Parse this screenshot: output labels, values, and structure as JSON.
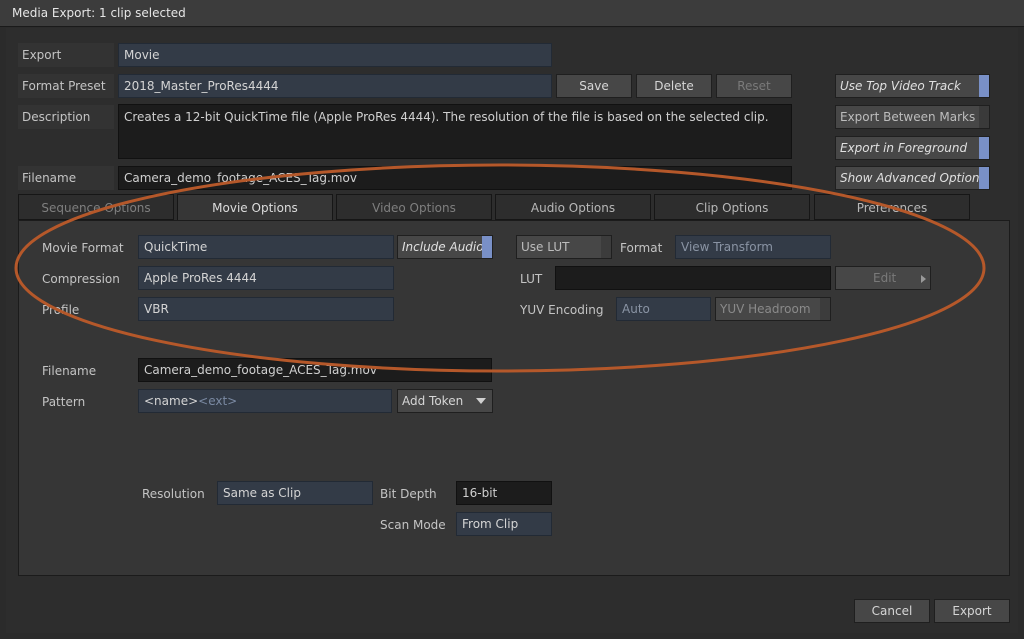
{
  "window": {
    "title": "Media Export: 1 clip selected"
  },
  "export": {
    "label": "Export",
    "value": "Movie"
  },
  "format_preset": {
    "label": "Format Preset",
    "value": "2018_Master_ProRes4444",
    "save": "Save",
    "delete": "Delete",
    "reset": "Reset"
  },
  "description": {
    "label": "Description",
    "value": "Creates a 12-bit QuickTime file (Apple ProRes 4444).  The resolution of the file is based on the selected clip."
  },
  "filename_top": {
    "label": "Filename",
    "value": "Camera_demo_footage_ACES_Tag.mov"
  },
  "toggles": {
    "use_top_video_track": "Use Top Video Track",
    "export_between_marks": "Export Between Marks",
    "export_in_foreground": "Export in Foreground",
    "show_advanced_options": "Show Advanced Options"
  },
  "tabs": [
    "Sequence Options",
    "Movie Options",
    "Video Options",
    "Audio Options",
    "Clip Options",
    "Preferences"
  ],
  "movie_options": {
    "movie_format_label": "Movie Format",
    "movie_format_value": "QuickTime",
    "include_audio": "Include Audio",
    "compression_label": "Compression",
    "compression_value": "Apple ProRes 4444",
    "profile_label": "Profile",
    "profile_value": "VBR",
    "use_lut": "Use LUT",
    "format_label": "Format",
    "format_value": "View Transform",
    "lut_label": "LUT",
    "lut_value": "",
    "edit": "Edit",
    "yuv_encoding_label": "YUV Encoding",
    "yuv_encoding_value": "Auto",
    "yuv_headroom": "YUV Headroom",
    "filename_label": "Filename",
    "filename_value": "Camera_demo_footage_ACES_Tag.mov",
    "pattern_label": "Pattern",
    "pattern_name": "<name>",
    "pattern_ext": "<ext>",
    "add_token": "Add Token",
    "resolution_label": "Resolution",
    "resolution_value": "Same as Clip",
    "bit_depth_label": "Bit Depth",
    "bit_depth_value": "16-bit",
    "scan_mode_label": "Scan Mode",
    "scan_mode_value": "From Clip"
  },
  "footer": {
    "cancel": "Cancel",
    "export": "Export"
  },
  "colors": {
    "accent": "#7990c7",
    "highlight_ellipse": "#b5582a",
    "field_bg": "#333b47"
  }
}
